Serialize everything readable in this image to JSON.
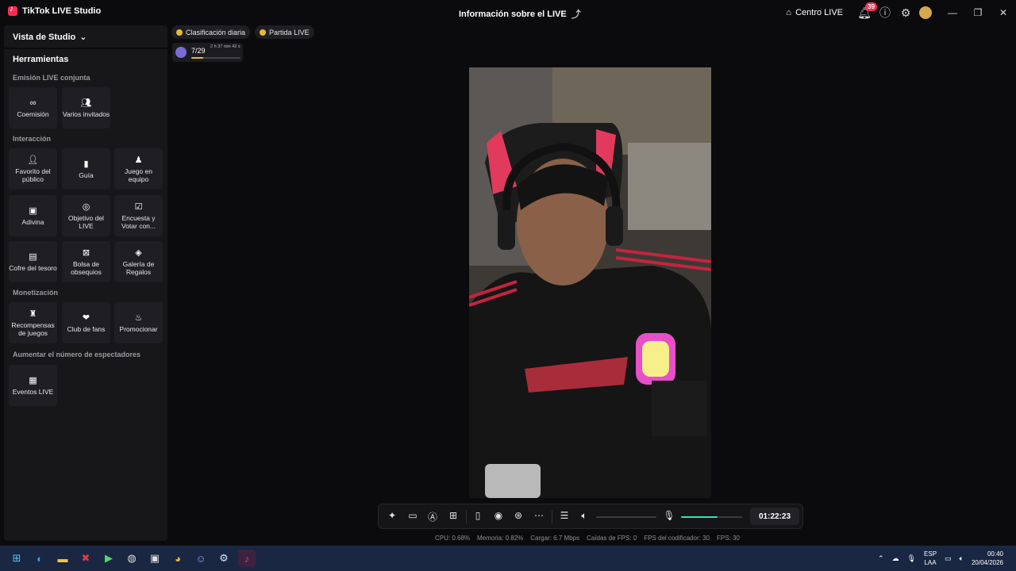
{
  "titlebar": {
    "app_name": "TikTok LIVE Studio",
    "center_title": "Información sobre el LIVE",
    "centro_live": "Centro LIVE",
    "notification_count": "39"
  },
  "sidebar": {
    "studio_view": "Vista de Studio",
    "tools_title": "Herramientas",
    "sections": {
      "joint": "Emisión LIVE conjunta",
      "interaction": "Interacción",
      "monetization": "Monetización",
      "viewers": "Aumentar el número de espectadores"
    },
    "tiles": {
      "coemision": "Coemisión",
      "varios_invitados": "Varios invitados",
      "favorito": "Favorito del público",
      "guia": "Guía",
      "juego_equipo": "Juego en equipo",
      "adivina": "Adivina",
      "objetivo": "Objetivo del LIVE",
      "encuesta": "Encuesta y Votar con...",
      "cofre": "Cofre del tesoro",
      "bolsa": "Bolsa de obsequios",
      "galeria": "Galería de Regalos",
      "recompensas": "Recompensas de juegos",
      "club": "Club de fans",
      "promocionar": "Promocionar",
      "eventos": "Eventos LIVE"
    }
  },
  "top_chips": {
    "ranking": "Clasificación diaria",
    "partida": "Partida LIVE"
  },
  "progress": {
    "count": "7/29",
    "time": "2 h 37 min 42 s",
    "fraction": 0.24
  },
  "controls": {
    "timer": "01:22:23",
    "speaker_level": 0.0,
    "mic_level": 0.6
  },
  "stats": {
    "cpu": "CPU:  0.68%",
    "memory": "Memoria:  0.82%",
    "upload": "Cargar:  6.7 Mbps",
    "fps_drops": "Caídas de FPS:  0",
    "encoder_fps": "FPS del codificador:  30",
    "fps": "FPS:  30"
  },
  "taskbar": {
    "lang_top": "ESP",
    "lang_bottom": "LAA",
    "time": "00:40",
    "date": "20/04/2026"
  },
  "colors": {
    "accent": "#fe2c55",
    "mic_level": "#2ee6b6",
    "gold": "#e9b83a"
  }
}
